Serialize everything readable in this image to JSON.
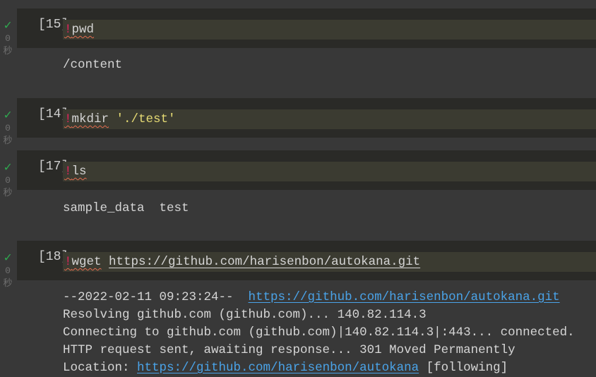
{
  "cells": [
    {
      "count": "[15]",
      "status_time": "0",
      "status_unit": "秒",
      "bang": "!",
      "cmd": "pwd",
      "output": [
        "/content"
      ]
    },
    {
      "count": "[14]",
      "status_time": "0",
      "status_unit": "秒",
      "bang": "!",
      "cmd": "mkdir",
      "arg": "'./test'"
    },
    {
      "count": "[17]",
      "status_time": "0",
      "status_unit": "秒",
      "bang": "!",
      "cmd": "ls",
      "output": [
        "sample_data  test"
      ]
    },
    {
      "count": "[18]",
      "status_time": "0",
      "status_unit": "秒",
      "bang": "!",
      "cmd": "wget",
      "arg": "https://github.com/harisenbon/autokana.git",
      "output_first_prefix": "--2022-02-11 09:23:24--  ",
      "output_first_link": "https://github.com/harisenbon/autokana.git",
      "output": [
        "Resolving github.com (github.com)... 140.82.114.3",
        "Connecting to github.com (github.com)|140.82.114.3|:443... connected.",
        "HTTP request sent, awaiting response... 301 Moved Permanently"
      ],
      "output_last_prefix": "Location: ",
      "output_last_link": "https://github.com/harisenbon/autokana",
      "output_last_suffix": " [following]"
    }
  ],
  "colors": {
    "success": "#2fa84f",
    "link": "#4aa3e8",
    "bang": "#e0245e",
    "string": "#e6db74"
  }
}
